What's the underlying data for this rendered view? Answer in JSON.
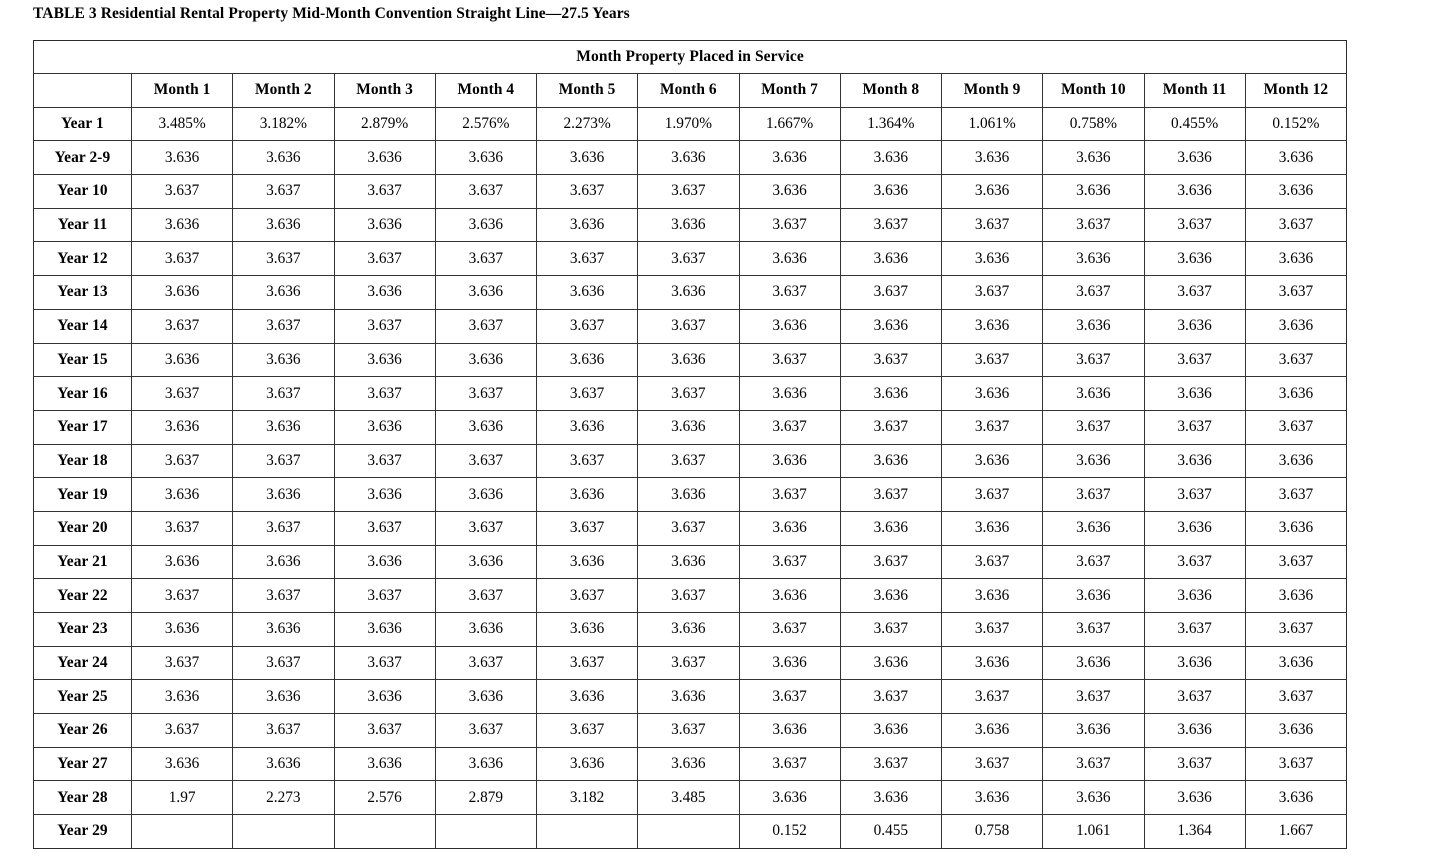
{
  "caption": "TABLE 3 Residential Rental Property Mid-Month Convention Straight Line—27.5 Years",
  "table": {
    "spanner_header": "Month Property Placed in Service",
    "corner_header": "",
    "column_headers": [
      "Month 1",
      "Month 2",
      "Month 3",
      "Month 4",
      "Month 5",
      "Month 6",
      "Month 7",
      "Month 8",
      "Month 9",
      "Month 10",
      "Month 11",
      "Month 12"
    ],
    "rows": [
      {
        "label": "Year 1",
        "values": [
          "3.485%",
          "3.182%",
          "2.879%",
          "2.576%",
          "2.273%",
          "1.970%",
          "1.667%",
          "1.364%",
          "1.061%",
          "0.758%",
          "0.455%",
          "0.152%"
        ]
      },
      {
        "label": "Year 2-9",
        "values": [
          "3.636",
          "3.636",
          "3.636",
          "3.636",
          "3.636",
          "3.636",
          "3.636",
          "3.636",
          "3.636",
          "3.636",
          "3.636",
          "3.636"
        ]
      },
      {
        "label": "Year 10",
        "values": [
          "3.637",
          "3.637",
          "3.637",
          "3.637",
          "3.637",
          "3.637",
          "3.636",
          "3.636",
          "3.636",
          "3.636",
          "3.636",
          "3.636"
        ]
      },
      {
        "label": "Year 11",
        "values": [
          "3.636",
          "3.636",
          "3.636",
          "3.636",
          "3.636",
          "3.636",
          "3.637",
          "3.637",
          "3.637",
          "3.637",
          "3.637",
          "3.637"
        ]
      },
      {
        "label": "Year 12",
        "values": [
          "3.637",
          "3.637",
          "3.637",
          "3.637",
          "3.637",
          "3.637",
          "3.636",
          "3.636",
          "3.636",
          "3.636",
          "3.636",
          "3.636"
        ]
      },
      {
        "label": "Year 13",
        "values": [
          "3.636",
          "3.636",
          "3.636",
          "3.636",
          "3.636",
          "3.636",
          "3.637",
          "3.637",
          "3.637",
          "3.637",
          "3.637",
          "3.637"
        ]
      },
      {
        "label": "Year 14",
        "values": [
          "3.637",
          "3.637",
          "3.637",
          "3.637",
          "3.637",
          "3.637",
          "3.636",
          "3.636",
          "3.636",
          "3.636",
          "3.636",
          "3.636"
        ]
      },
      {
        "label": "Year 15",
        "values": [
          "3.636",
          "3.636",
          "3.636",
          "3.636",
          "3.636",
          "3.636",
          "3.637",
          "3.637",
          "3.637",
          "3.637",
          "3.637",
          "3.637"
        ]
      },
      {
        "label": "Year 16",
        "values": [
          "3.637",
          "3.637",
          "3.637",
          "3.637",
          "3.637",
          "3.637",
          "3.636",
          "3.636",
          "3.636",
          "3.636",
          "3.636",
          "3.636"
        ]
      },
      {
        "label": "Year 17",
        "values": [
          "3.636",
          "3.636",
          "3.636",
          "3.636",
          "3.636",
          "3.636",
          "3.637",
          "3.637",
          "3.637",
          "3.637",
          "3.637",
          "3.637"
        ]
      },
      {
        "label": "Year 18",
        "values": [
          "3.637",
          "3.637",
          "3.637",
          "3.637",
          "3.637",
          "3.637",
          "3.636",
          "3.636",
          "3.636",
          "3.636",
          "3.636",
          "3.636"
        ]
      },
      {
        "label": "Year 19",
        "values": [
          "3.636",
          "3.636",
          "3.636",
          "3.636",
          "3.636",
          "3.636",
          "3.637",
          "3.637",
          "3.637",
          "3.637",
          "3.637",
          "3.637"
        ]
      },
      {
        "label": "Year 20",
        "values": [
          "3.637",
          "3.637",
          "3.637",
          "3.637",
          "3.637",
          "3.637",
          "3.636",
          "3.636",
          "3.636",
          "3.636",
          "3.636",
          "3.636"
        ]
      },
      {
        "label": "Year 21",
        "values": [
          "3.636",
          "3.636",
          "3.636",
          "3.636",
          "3.636",
          "3.636",
          "3.637",
          "3.637",
          "3.637",
          "3.637",
          "3.637",
          "3.637"
        ]
      },
      {
        "label": "Year 22",
        "values": [
          "3.637",
          "3.637",
          "3.637",
          "3.637",
          "3.637",
          "3.637",
          "3.636",
          "3.636",
          "3.636",
          "3.636",
          "3.636",
          "3.636"
        ]
      },
      {
        "label": "Year 23",
        "values": [
          "3.636",
          "3.636",
          "3.636",
          "3.636",
          "3.636",
          "3.636",
          "3.637",
          "3.637",
          "3.637",
          "3.637",
          "3.637",
          "3.637"
        ]
      },
      {
        "label": "Year 24",
        "values": [
          "3.637",
          "3.637",
          "3.637",
          "3.637",
          "3.637",
          "3.637",
          "3.636",
          "3.636",
          "3.636",
          "3.636",
          "3.636",
          "3.636"
        ]
      },
      {
        "label": "Year 25",
        "values": [
          "3.636",
          "3.636",
          "3.636",
          "3.636",
          "3.636",
          "3.636",
          "3.637",
          "3.637",
          "3.637",
          "3.637",
          "3.637",
          "3.637"
        ]
      },
      {
        "label": "Year 26",
        "values": [
          "3.637",
          "3.637",
          "3.637",
          "3.637",
          "3.637",
          "3.637",
          "3.636",
          "3.636",
          "3.636",
          "3.636",
          "3.636",
          "3.636"
        ]
      },
      {
        "label": "Year 27",
        "values": [
          "3.636",
          "3.636",
          "3.636",
          "3.636",
          "3.636",
          "3.636",
          "3.637",
          "3.637",
          "3.637",
          "3.637",
          "3.637",
          "3.637"
        ]
      },
      {
        "label": "Year 28",
        "values": [
          "1.97",
          "2.273",
          "2.576",
          "2.879",
          "3.182",
          "3.485",
          "3.636",
          "3.636",
          "3.636",
          "3.636",
          "3.636",
          "3.636"
        ]
      },
      {
        "label": "Year 29",
        "values": [
          "",
          "",
          "",
          "",
          "",
          "",
          "0.152",
          "0.455",
          "0.758",
          "1.061",
          "1.364",
          "1.667"
        ]
      }
    ]
  },
  "chart_data": {
    "type": "table",
    "title": "TABLE 3 Residential Rental Property Mid-Month Convention Straight Line—27.5 Years",
    "spanner": "Month Property Placed in Service",
    "columns": [
      "",
      "Month 1",
      "Month 2",
      "Month 3",
      "Month 4",
      "Month 5",
      "Month 6",
      "Month 7",
      "Month 8",
      "Month 9",
      "Month 10",
      "Month 11",
      "Month 12"
    ],
    "row_labels": [
      "Year 1",
      "Year 2-9",
      "Year 10",
      "Year 11",
      "Year 12",
      "Year 13",
      "Year 14",
      "Year 15",
      "Year 16",
      "Year 17",
      "Year 18",
      "Year 19",
      "Year 20",
      "Year 21",
      "Year 22",
      "Year 23",
      "Year 24",
      "Year 25",
      "Year 26",
      "Year 27",
      "Year 28",
      "Year 29"
    ],
    "values": [
      [
        3.485,
        3.182,
        2.879,
        2.576,
        2.273,
        1.97,
        1.667,
        1.364,
        1.061,
        0.758,
        0.455,
        0.152
      ],
      [
        3.636,
        3.636,
        3.636,
        3.636,
        3.636,
        3.636,
        3.636,
        3.636,
        3.636,
        3.636,
        3.636,
        3.636
      ],
      [
        3.637,
        3.637,
        3.637,
        3.637,
        3.637,
        3.637,
        3.636,
        3.636,
        3.636,
        3.636,
        3.636,
        3.636
      ],
      [
        3.636,
        3.636,
        3.636,
        3.636,
        3.636,
        3.636,
        3.637,
        3.637,
        3.637,
        3.637,
        3.637,
        3.637
      ],
      [
        3.637,
        3.637,
        3.637,
        3.637,
        3.637,
        3.637,
        3.636,
        3.636,
        3.636,
        3.636,
        3.636,
        3.636
      ],
      [
        3.636,
        3.636,
        3.636,
        3.636,
        3.636,
        3.636,
        3.637,
        3.637,
        3.637,
        3.637,
        3.637,
        3.637
      ],
      [
        3.637,
        3.637,
        3.637,
        3.637,
        3.637,
        3.637,
        3.636,
        3.636,
        3.636,
        3.636,
        3.636,
        3.636
      ],
      [
        3.636,
        3.636,
        3.636,
        3.636,
        3.636,
        3.636,
        3.637,
        3.637,
        3.637,
        3.637,
        3.637,
        3.637
      ],
      [
        3.637,
        3.637,
        3.637,
        3.637,
        3.637,
        3.637,
        3.636,
        3.636,
        3.636,
        3.636,
        3.636,
        3.636
      ],
      [
        3.636,
        3.636,
        3.636,
        3.636,
        3.636,
        3.636,
        3.637,
        3.637,
        3.637,
        3.637,
        3.637,
        3.637
      ],
      [
        3.637,
        3.637,
        3.637,
        3.637,
        3.637,
        3.637,
        3.636,
        3.636,
        3.636,
        3.636,
        3.636,
        3.636
      ],
      [
        3.636,
        3.636,
        3.636,
        3.636,
        3.636,
        3.636,
        3.637,
        3.637,
        3.637,
        3.637,
        3.637,
        3.637
      ],
      [
        3.637,
        3.637,
        3.637,
        3.637,
        3.637,
        3.637,
        3.636,
        3.636,
        3.636,
        3.636,
        3.636,
        3.636
      ],
      [
        3.636,
        3.636,
        3.636,
        3.636,
        3.636,
        3.636,
        3.637,
        3.637,
        3.637,
        3.637,
        3.637,
        3.637
      ],
      [
        3.637,
        3.637,
        3.637,
        3.637,
        3.637,
        3.637,
        3.636,
        3.636,
        3.636,
        3.636,
        3.636,
        3.636
      ],
      [
        3.636,
        3.636,
        3.636,
        3.636,
        3.636,
        3.636,
        3.637,
        3.637,
        3.637,
        3.637,
        3.637,
        3.637
      ],
      [
        3.637,
        3.637,
        3.637,
        3.637,
        3.637,
        3.637,
        3.636,
        3.636,
        3.636,
        3.636,
        3.636,
        3.636
      ],
      [
        3.636,
        3.636,
        3.636,
        3.636,
        3.636,
        3.636,
        3.637,
        3.637,
        3.637,
        3.637,
        3.637,
        3.637
      ],
      [
        3.637,
        3.637,
        3.637,
        3.637,
        3.637,
        3.637,
        3.636,
        3.636,
        3.636,
        3.636,
        3.636,
        3.636
      ],
      [
        3.636,
        3.636,
        3.636,
        3.636,
        3.636,
        3.636,
        3.637,
        3.637,
        3.637,
        3.637,
        3.637,
        3.637
      ],
      [
        1.97,
        2.273,
        2.576,
        2.879,
        3.182,
        3.485,
        3.636,
        3.636,
        3.636,
        3.636,
        3.636,
        3.636
      ],
      [
        null,
        null,
        null,
        null,
        null,
        null,
        0.152,
        0.455,
        0.758,
        1.061,
        1.364,
        1.667
      ]
    ],
    "unit": "percent",
    "notes": "Year 1 values are displayed with a percent sign; all later rows omit the sign. Year 28 Month 1 is shown as 1.97 (two decimals). Year 29 Months 1-6 are blank."
  }
}
